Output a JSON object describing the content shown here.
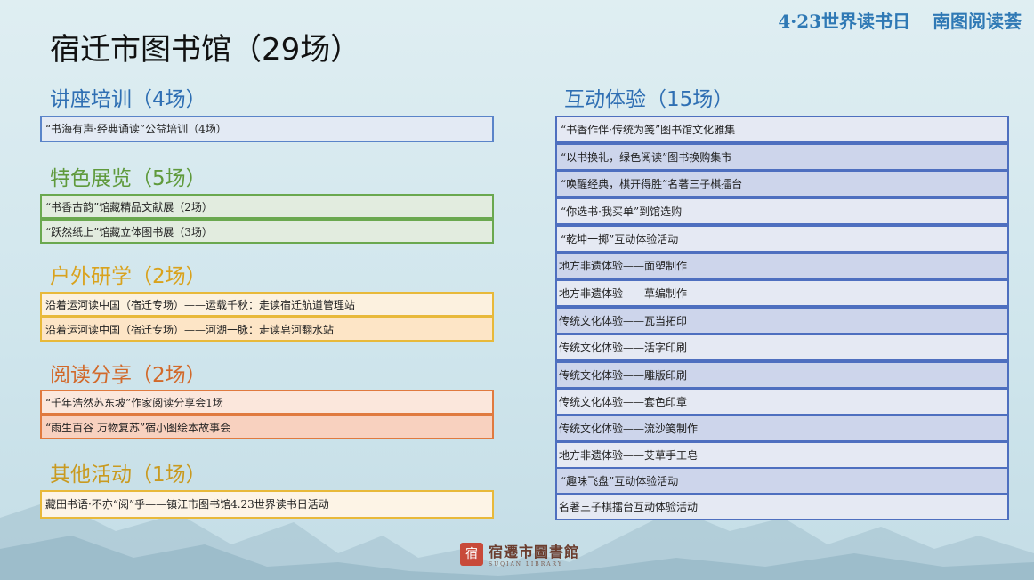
{
  "banner": {
    "date_event": "4·23世界读书日",
    "brand": "南图阅读荟"
  },
  "title": "宿迁市图书馆（29场）",
  "left_sections": [
    {
      "title": "讲座培训（4场）",
      "color": "#2f6fb3",
      "items": [
        "“书海有声·经典诵读”公益培训（4场）"
      ]
    },
    {
      "title": "特色展览（5场）",
      "color": "#5f9a3c",
      "items": [
        "“书香古韵”馆藏精品文献展（2场）",
        "“跃然纸上”馆藏立体图书展（3场）"
      ]
    },
    {
      "title": "户外研学（2场）",
      "color": "#d9a21c",
      "items": [
        "沿着运河读中国（宿迁专场）——运载千秋：走读宿迁航道管理站",
        "沿着运河读中国（宿迁专场）——河湖一脉：走读皂河翻水站"
      ]
    },
    {
      "title": "阅读分享（2场）",
      "color": "#d2692a",
      "items": [
        "“千年浩然苏东坡”作家阅读分享会1场",
        "“雨生百谷 万物复苏”宿小图绘本故事会"
      ]
    },
    {
      "title": "其他活动（1场）",
      "color": "#c99a20",
      "items": [
        "藏田书语·不亦“阅”乎——镇江市图书馆4.23世界读书日活动"
      ]
    }
  ],
  "right_section": {
    "title": "互动体验（15场）",
    "color": "#2f6fb3",
    "items": [
      "“书香作伴·传统为笺”图书馆文化雅集",
      "“以书换礼，绿色阅读”图书换购集市",
      "“唤醒经典，棋开得胜”名著三子棋擂台",
      "“你选书·我买单”到馆选购",
      "“乾坤一掷”互动体验活动",
      "地方非遗体验——面塑制作",
      "地方非遗体验——草编制作",
      "传统文化体验——瓦当拓印",
      "传统文化体验——活字印刷",
      "传统文化体验——雕版印刷",
      "传统文化体验——套色印章",
      "传统文化体验——流沙笺制作",
      "地方非遗体验——艾草手工皂",
      "“趣味飞盘”互动体验活动",
      "名著三子棋擂台互动体验活动"
    ]
  },
  "logo": {
    "mark": "宿",
    "name": "宿遷市圖書館",
    "en": "SUQIAN LIBRARY"
  }
}
